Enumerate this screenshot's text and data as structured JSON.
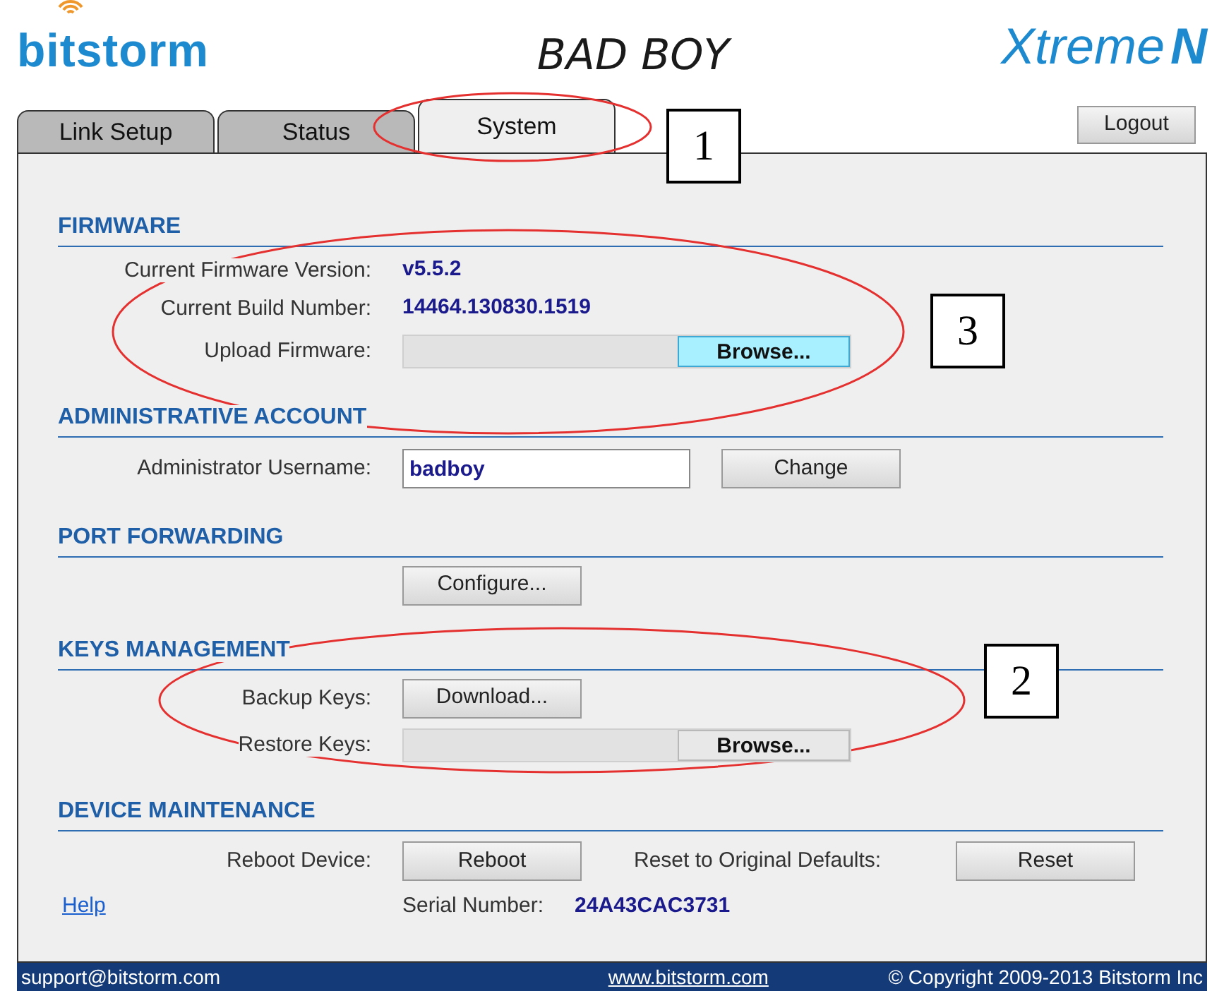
{
  "header": {
    "brand": "bitstorm",
    "product": "BAD BOY",
    "logo_main": "Xtreme",
    "logo_suffix": "N"
  },
  "tabs": [
    {
      "label": "Link Setup",
      "selected": false
    },
    {
      "label": "Status",
      "selected": false
    },
    {
      "label": "System",
      "selected": true
    }
  ],
  "logout": "Logout",
  "sections": [
    {
      "title": "FIRMWARE",
      "rows": [
        {
          "kind": "value",
          "label": "Current Firmware Version:",
          "value": "v5.5.2"
        },
        {
          "kind": "value",
          "label": "Current Build Number:",
          "value": "14464.130830.1519"
        },
        {
          "kind": "file",
          "label": "Upload Firmware:",
          "button": "Browse...",
          "highlighted": true
        }
      ]
    },
    {
      "title": "ADMINISTRATIVE ACCOUNT",
      "rows": [
        {
          "kind": "input",
          "label": "Administrator Username:",
          "value": "badboy",
          "button": "Change"
        }
      ]
    },
    {
      "title": "PORT FORWARDING",
      "rows": [
        {
          "kind": "button",
          "button": "Configure..."
        }
      ]
    },
    {
      "title": "KEYS MANAGEMENT",
      "rows": [
        {
          "kind": "button",
          "label": "Backup Keys:",
          "button": "Download..."
        },
        {
          "kind": "file",
          "label": "Restore Keys:",
          "button": "Browse...",
          "highlighted": false
        }
      ]
    },
    {
      "title": "DEVICE MAINTENANCE",
      "rows": [
        {
          "kind": "button2",
          "label": "Reboot Device:",
          "button": "Reboot",
          "label2": "Reset to Original Defaults:",
          "button2": "Reset"
        },
        {
          "kind": "serial",
          "link": "Help",
          "label": "Serial Number:",
          "value": "24A43CAC3731"
        }
      ]
    }
  ],
  "footer": {
    "email": "support@bitstorm.com",
    "website": "www.bitstorm.com",
    "copyright": "© Copyright 2009-2013 Bitstorm Inc"
  },
  "callouts": [
    {
      "number": "1"
    },
    {
      "number": "3"
    },
    {
      "number": "2"
    }
  ]
}
